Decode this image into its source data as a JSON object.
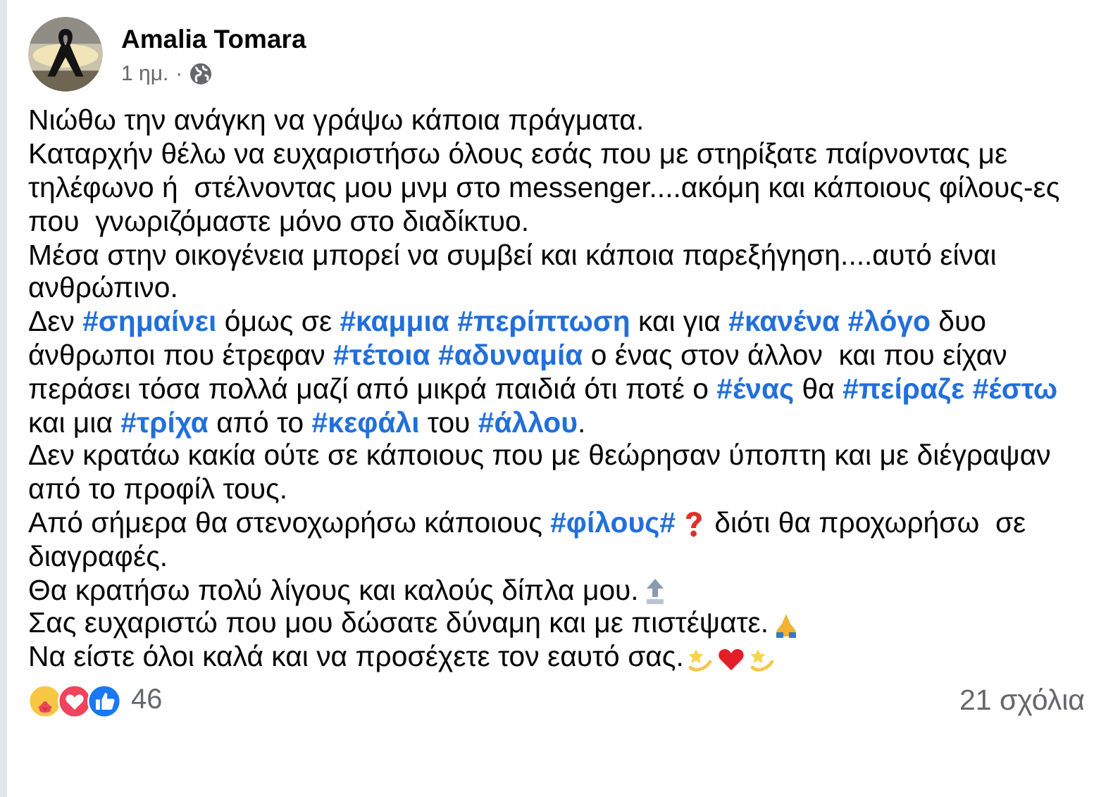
{
  "post": {
    "author": "Amalia Tomara",
    "time": "1 ημ.",
    "separator": "·"
  },
  "lines": [
    {
      "segments": [
        {
          "kind": "text",
          "text": "Νιώθω την ανάγκη να γράψω κάποια πράγματα."
        }
      ]
    },
    {
      "segments": [
        {
          "kind": "text",
          "text": "Καταρχήν θέλω να ευχαριστήσω όλους εσάς που με στηρίξατε παίρνοντας με"
        }
      ]
    },
    {
      "segments": [
        {
          "kind": "text",
          "text": "τηλέφωνο ή  στέλνοντας μου μνμ στο messenger....ακόμη και κάποιους φίλους-ες"
        }
      ]
    },
    {
      "segments": [
        {
          "kind": "text",
          "text": "που  γνωριζόμαστε μόνο στο διαδίκτυο."
        }
      ]
    },
    {
      "segments": [
        {
          "kind": "text",
          "text": "Μέσα στην οικογένεια μπορεί να συμβεί και κάποια παρεξήγηση....αυτό είναι"
        }
      ]
    },
    {
      "segments": [
        {
          "kind": "text",
          "text": "ανθρώπινο."
        }
      ]
    },
    {
      "segments": [
        {
          "kind": "text",
          "text": "Δεν "
        },
        {
          "kind": "hashtag",
          "text": "#σημαίνει"
        },
        {
          "kind": "text",
          "text": " όμως σε "
        },
        {
          "kind": "hashtag",
          "text": "#καμμια"
        },
        {
          "kind": "space"
        },
        {
          "kind": "hashtag",
          "text": "#περίπτωση"
        },
        {
          "kind": "text",
          "text": " και για "
        },
        {
          "kind": "hashtag",
          "text": "#κανένα"
        },
        {
          "kind": "space"
        },
        {
          "kind": "hashtag",
          "text": "#λόγο"
        },
        {
          "kind": "text",
          "text": " δυο"
        }
      ]
    },
    {
      "segments": [
        {
          "kind": "text",
          "text": "άνθρωποι που έτρεφαν "
        },
        {
          "kind": "hashtag",
          "text": "#τέτοια"
        },
        {
          "kind": "space"
        },
        {
          "kind": "hashtag",
          "text": "#αδυναμία"
        },
        {
          "kind": "text",
          "text": " ο ένας στον άλλον  και που είχαν"
        }
      ]
    },
    {
      "segments": [
        {
          "kind": "text",
          "text": "περάσει τόσα πολλά μαζί από μικρά παιδιά ότι ποτέ ο "
        },
        {
          "kind": "hashtag",
          "text": "#ένας"
        },
        {
          "kind": "text",
          "text": " θα "
        },
        {
          "kind": "hashtag",
          "text": "#πείραζε"
        },
        {
          "kind": "space"
        },
        {
          "kind": "hashtag",
          "text": "#έστω"
        }
      ]
    },
    {
      "segments": [
        {
          "kind": "text",
          "text": "και μια "
        },
        {
          "kind": "hashtag",
          "text": "#τρίχα"
        },
        {
          "kind": "text",
          "text": " από το "
        },
        {
          "kind": "hashtag",
          "text": "#κεφάλι"
        },
        {
          "kind": "text",
          "text": " του "
        },
        {
          "kind": "hashtag",
          "text": "#άλλου"
        },
        {
          "kind": "text",
          "text": "."
        }
      ]
    },
    {
      "segments": [
        {
          "kind": "text",
          "text": "Δεν κρατάω κακία ούτε σε κάποιους που με θεώρησαν ύποπτη και με διέγραψαν"
        }
      ]
    },
    {
      "segments": [
        {
          "kind": "text",
          "text": "από το προφίλ τους."
        }
      ]
    },
    {
      "segments": [
        {
          "kind": "text",
          "text": "Από σήμερα θα στενοχωρήσω κάποιους "
        },
        {
          "kind": "hashtag",
          "text": "#φίλους#"
        },
        {
          "kind": "question"
        },
        {
          "kind": "text",
          "text": " διότι θα προχωρήσω  σε"
        }
      ]
    },
    {
      "segments": [
        {
          "kind": "text",
          "text": "διαγραφές."
        }
      ]
    },
    {
      "segments": [
        {
          "kind": "text",
          "text": "Θα κρατήσω πολύ λίγους και καλούς δίπλα μου."
        },
        {
          "kind": "top"
        }
      ]
    },
    {
      "segments": [
        {
          "kind": "text",
          "text": "Σας ευχαριστώ που μου δώσατε δύναμη και με πιστέψατε."
        },
        {
          "kind": "pray"
        }
      ]
    },
    {
      "segments": [
        {
          "kind": "text",
          "text": "Να είστε όλοι καλά και να προσέχετε τον εαυτό σας."
        },
        {
          "kind": "dizzy"
        },
        {
          "kind": "heart"
        },
        {
          "kind": "dizzy"
        }
      ]
    }
  ],
  "footer": {
    "reactions": [
      {
        "kind": "care"
      },
      {
        "kind": "love"
      },
      {
        "kind": "like"
      }
    ],
    "reaction_count": "46",
    "comments": "21 σχόλια"
  }
}
